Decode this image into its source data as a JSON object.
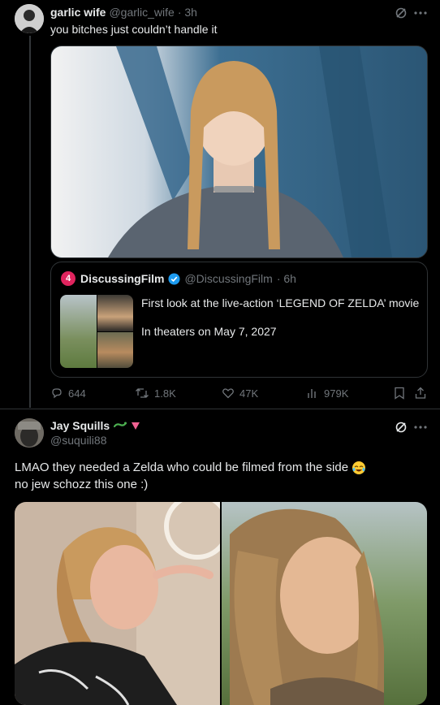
{
  "post1": {
    "display_name": "garlic wife",
    "handle": "@garlic_wife",
    "time": "· 3h",
    "text": "you bitches just couldn’t handle it",
    "quote": {
      "display_name": "DiscussingFilm",
      "handle": "@DiscussingFilm",
      "time": "· 6h",
      "line1": "First look at the live-action ‘LEGEND OF ZELDA’ movie",
      "line2": "In theaters on May 7, 2027"
    },
    "actions": {
      "replies": "644",
      "reposts": "1.8K",
      "likes": "47K",
      "views": "979K"
    }
  },
  "post2": {
    "display_name": "Jay Squills",
    "handle": "@suquili88",
    "line1": "LMAO they needed a Zelda who could be filmed from the side",
    "line2": "no jew schozz this one :)"
  },
  "colors": {
    "background": "#000000",
    "text": "#e7e9ea",
    "muted": "#71767b",
    "border": "#2f3336",
    "verified": "#1d9bf0",
    "discussingfilm_red": "#e0245e"
  }
}
